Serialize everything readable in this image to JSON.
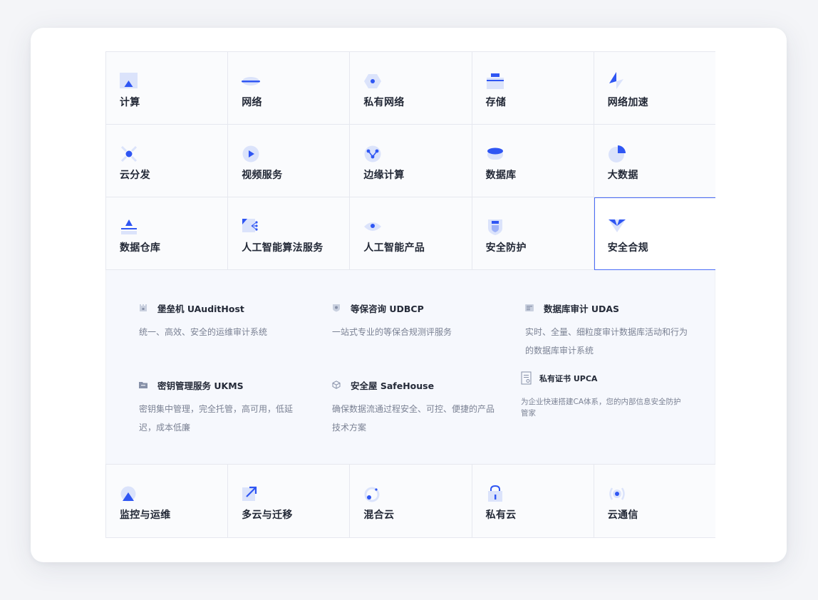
{
  "categories_top": [
    {
      "label": "计算",
      "icon": "compute-icon"
    },
    {
      "label": "网络",
      "icon": "network-icon"
    },
    {
      "label": "私有网络",
      "icon": "private-network-icon"
    },
    {
      "label": "存储",
      "icon": "storage-icon"
    },
    {
      "label": "网络加速",
      "icon": "network-acceleration-icon"
    },
    {
      "label": "云分发",
      "icon": "cdn-icon"
    },
    {
      "label": "视频服务",
      "icon": "video-service-icon"
    },
    {
      "label": "边缘计算",
      "icon": "edge-computing-icon"
    },
    {
      "label": "数据库",
      "icon": "database-icon"
    },
    {
      "label": "大数据",
      "icon": "big-data-icon"
    },
    {
      "label": "数据仓库",
      "icon": "data-warehouse-icon"
    },
    {
      "label": "人工智能算法服务",
      "icon": "ai-algorithm-icon"
    },
    {
      "label": "人工智能产品",
      "icon": "ai-product-icon"
    },
    {
      "label": "安全防护",
      "icon": "security-protection-icon"
    },
    {
      "label": "安全合规",
      "icon": "security-compliance-icon"
    }
  ],
  "active_category": "安全合规",
  "products": [
    {
      "title": "堡垒机 UAuditHost",
      "desc": "统一、高效、安全的运维审计系统",
      "icon": "bastion-host-icon"
    },
    {
      "title": "等保咨询 UDBCP",
      "desc": "一站式专业的等保合规测评服务",
      "icon": "shield-icon"
    },
    {
      "title": "数据库审计 UDAS",
      "desc": "实时、全量、细粒度审计数据库活动和行为的数据库审计系统",
      "icon": "database-audit-icon"
    },
    {
      "title": "密钥管理服务 UKMS",
      "desc": "密钥集中管理，完全托管，高可用，低延迟，成本低廉",
      "icon": "folder-icon"
    },
    {
      "title": "安全屋 SafeHouse",
      "desc": "确保数据流通过程安全、可控、便捷的产品技术方案",
      "icon": "cube-icon"
    },
    {
      "title": "私有证书 UPCA",
      "desc": "为企业快速搭建CA体系，您的内部信息安全防护管家",
      "icon": "certificate-icon"
    }
  ],
  "categories_bottom": [
    {
      "label": "监控与运维",
      "icon": "monitoring-icon"
    },
    {
      "label": "多云与迁移",
      "icon": "migration-icon"
    },
    {
      "label": "混合云",
      "icon": "hybrid-cloud-icon"
    },
    {
      "label": "私有云",
      "icon": "private-cloud-icon"
    },
    {
      "label": "云通信",
      "icon": "cloud-communication-icon"
    }
  ],
  "colors": {
    "accent": "#4a6cf7",
    "light_accent": "#d7e0fb"
  }
}
